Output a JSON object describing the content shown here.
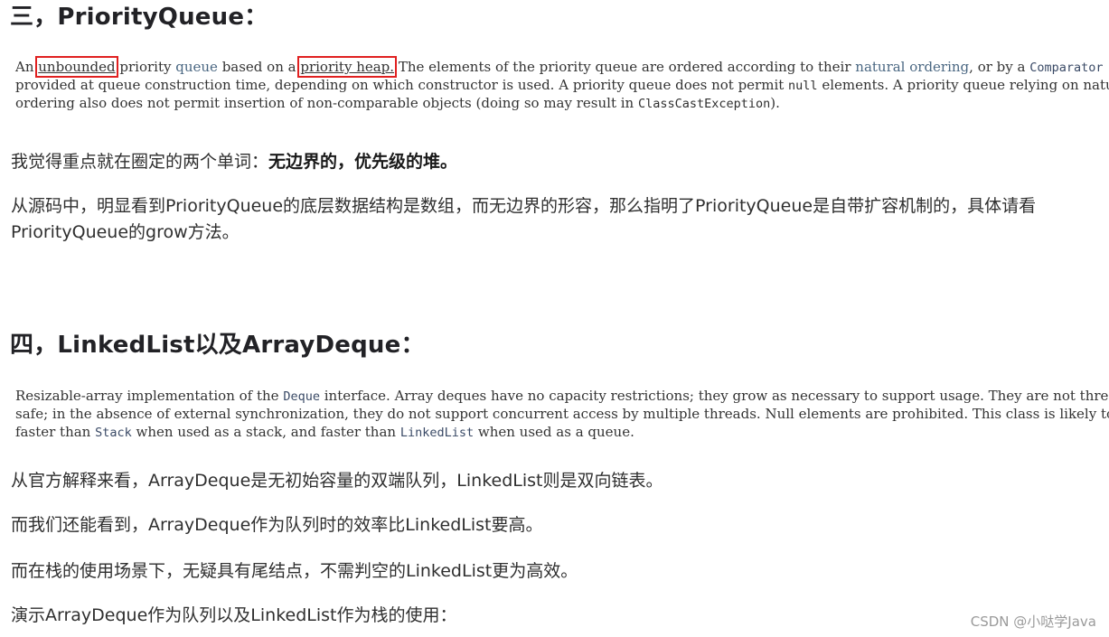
{
  "section3": {
    "heading": "三，PriorityQueue：",
    "doc": {
      "l1_an": "An ",
      "l1_unbounded": "unbounded",
      "l1_mid1": " priority ",
      "l1_queue_link": "queue",
      "l1_mid2": " based on a ",
      "l1_priority_heap": "priority heap.",
      "l1_mid3": " The elements of the priority queue are ordered according to their ",
      "l1_natural_ordering": "natural ordering",
      "l1_mid4": ", or by a ",
      "l1_comparator": "Comparator",
      "l2_a": "provided at queue construction time, depending on which constructor is used. A priority queue does not permit ",
      "l2_null": "null",
      "l2_b": " elements. A priority queue relying on natural",
      "l3_a": "ordering also does not permit insertion of non-comparable objects (doing so may result in ",
      "l3_exc": "ClassCastException",
      "l3_b": ")."
    },
    "p1_normal": "我觉得重点就在圈定的两个单词：",
    "p1_bold": "无边界的，优先级的堆。",
    "p2_line1": "从源码中，明显看到PriorityQueue的底层数据结构是数组，而无边界的形容，那么指明了PriorityQueue是自带扩容机制的，具体请看",
    "p2_line2": "PriorityQueue的grow方法。"
  },
  "section4": {
    "heading": "四，LinkedList以及ArrayDeque：",
    "doc": {
      "l1_a": "Resizable-array implementation of the ",
      "l1_deque": "Deque",
      "l1_b": " interface. Array deques have no capacity restrictions; they grow as necessary to support usage. They are not thread-",
      "l2": "safe; in the absence of external synchronization, they do not support concurrent access by multiple threads. Null elements are prohibited. This class is likely to be",
      "l3_a": "faster than ",
      "l3_stack": "Stack",
      "l3_b": " when used as a stack, and faster than ",
      "l3_linkedlist": "LinkedList",
      "l3_c": " when used as a queue."
    },
    "p3": "从官方解释来看，ArrayDeque是无初始容量的双端队列，LinkedList则是双向链表。",
    "p4": "而我们还能看到，ArrayDeque作为队列时的效率比LinkedList要高。",
    "p5": "而在栈的使用场景下，无疑具有尾结点，不需判空的LinkedList更为高效。",
    "p6": "演示ArrayDeque作为队列以及LinkedList作为栈的使用："
  },
  "watermark": "CSDN @小哒学Java"
}
